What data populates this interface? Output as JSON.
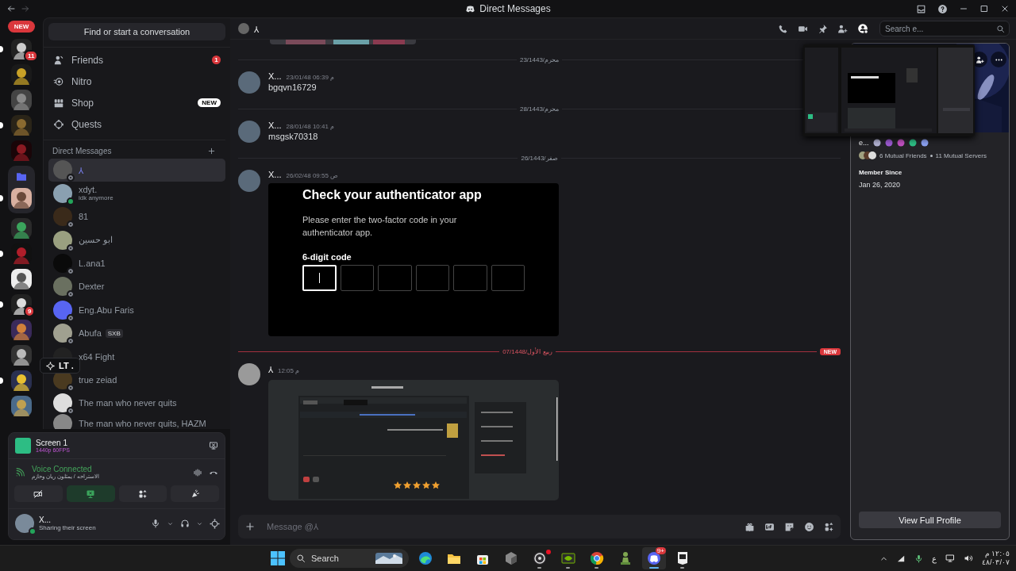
{
  "titlebar": {
    "title": "Direct Messages"
  },
  "rail": {
    "new_label": "NEW",
    "tooltip": "LT .",
    "servers": [
      {
        "kind": "server",
        "unread": true,
        "badge": "11"
      },
      {
        "kind": "server",
        "unread": false
      },
      {
        "kind": "server",
        "unread": false
      },
      {
        "kind": "server",
        "unread": true
      },
      {
        "kind": "server",
        "unread": false
      },
      {
        "kind": "folder",
        "children": [
          {
            "kind": "server",
            "unread": true
          }
        ]
      },
      {
        "kind": "server",
        "unread": false
      },
      {
        "kind": "server",
        "unread": true
      },
      {
        "kind": "server",
        "unread": false
      },
      {
        "kind": "server",
        "unread": true,
        "badge": "9"
      },
      {
        "kind": "server",
        "unread": false
      },
      {
        "kind": "server",
        "unread": false
      },
      {
        "kind": "server",
        "unread": true
      },
      {
        "kind": "server",
        "unread": false
      }
    ]
  },
  "sidebar": {
    "search": "Find or start a conversation",
    "nav": [
      {
        "label": "Friends",
        "badge": "1"
      },
      {
        "label": "Nitro"
      },
      {
        "label": "Shop",
        "tag": "NEW"
      },
      {
        "label": "Quests"
      }
    ],
    "dm_header": "Direct Messages",
    "dms": [
      {
        "name": "⅄",
        "online": false,
        "selected": true
      },
      {
        "name": "xdyt.",
        "online": true,
        "activity": "idk anymore",
        "selected": false
      },
      {
        "name": "81",
        "online": false,
        "selected": false
      },
      {
        "name": "ابو حسين",
        "online": false,
        "selected": false
      },
      {
        "name": "L.ana1",
        "online": false,
        "selected": false
      },
      {
        "name": "Dexter",
        "online": false,
        "selected": false
      },
      {
        "name": "Eng.Abu Faris",
        "online": false,
        "selected": false
      },
      {
        "name": "Abufa",
        "online": false,
        "tag": "SXB",
        "selected": false
      },
      {
        "name": "x64 Fight",
        "selected": false
      },
      {
        "name": "true zeiad",
        "online": false,
        "selected": false
      },
      {
        "name": "The man who never quits",
        "online": false,
        "selected": false
      },
      {
        "name": "The man who never quits, HAZM",
        "selected": false
      }
    ]
  },
  "stream": {
    "title": "Screen 1",
    "quality": "1440p 60FPS"
  },
  "voice": {
    "status": "Voice Connected",
    "channel": "الاستراحه / يمثلون ريان وحازم",
    "buttons": [
      {
        "active": false
      },
      {
        "active": true
      },
      {
        "active": false
      },
      {
        "active": false
      }
    ]
  },
  "user": {
    "name": "X...",
    "status": "Sharing their screen"
  },
  "chat": {
    "recipient": "⅄",
    "search": {
      "placeholder": "Search e..."
    },
    "items": [
      {
        "kind": "divider",
        "label": "23/1443/محرم",
        "new": false
      },
      {
        "kind": "message",
        "author": "X...",
        "time": "23/01/48 06:39 م",
        "text": "bgqvn16729"
      },
      {
        "kind": "divider",
        "label": "28/1443/محرم",
        "new": false
      },
      {
        "kind": "message",
        "author": "X...",
        "time": "28/01/48 10:41 م",
        "text": "msgsk70318"
      },
      {
        "kind": "divider",
        "label": "26/1443/صفر",
        "new": false
      },
      {
        "kind": "message",
        "author": "X...",
        "time": "26/02/48 09:55 ص",
        "attachment": {
          "kind": "auth",
          "title": "Check your authenticator app",
          "text": "Please enter the two-factor code in your authenticator app.",
          "field_label": "6-digit code",
          "boxes": [
            {
              "focused": true
            },
            {
              "focused": false
            },
            {
              "focused": false
            },
            {
              "focused": false
            },
            {
              "focused": false
            },
            {
              "focused": false
            }
          ]
        }
      },
      {
        "kind": "divider",
        "label": "07/1448/ربيع الأول",
        "new": true,
        "badge": "NEW"
      },
      {
        "kind": "message",
        "author": "⅄",
        "time": "12:05 م",
        "attachment": {
          "kind": "screenshot",
          "stars": 5
        }
      }
    ],
    "composer": {
      "placeholder": "Message @⅄"
    }
  },
  "profile": {
    "name": "e...",
    "mutual_friends": "6 Mutual Friends",
    "mutual_servers": "11 Mutual Servers",
    "member_since_label": "Member Since",
    "member_since": "Jan 26, 2020",
    "button": "View Full Profile"
  },
  "taskbar": {
    "search": "Search",
    "apps": [
      {
        "running": false,
        "active": false
      },
      {
        "running": false,
        "active": false
      },
      {
        "running": false,
        "active": false
      },
      {
        "running": false,
        "active": false
      },
      {
        "running": true,
        "active": false,
        "alert": true
      },
      {
        "running": true,
        "active": false
      },
      {
        "running": true,
        "active": false
      },
      {
        "running": false,
        "active": false
      },
      {
        "running": true,
        "active": true,
        "badge": "9+"
      },
      {
        "running": true,
        "active": false
      }
    ],
    "language": "ع",
    "time": "١٢:٠٥ م",
    "date": "٤٨/٠٣/٠٧"
  }
}
